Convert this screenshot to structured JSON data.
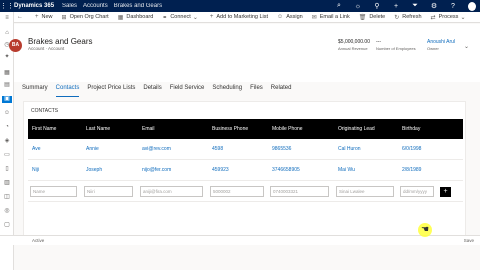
{
  "topbar": {
    "app_name": "Dynamics 365",
    "breadcrumbs": [
      "Sales",
      "Accounts",
      "Brakes and Gears"
    ],
    "icons": [
      "search-icon",
      "lightbulb-icon",
      "location-icon",
      "plus-icon",
      "filter-icon",
      "gear-icon",
      "help-icon"
    ]
  },
  "commands": [
    "New",
    "Open Org Chart",
    "Dashboard",
    "Connect",
    "Add to Marketing List",
    "Assign",
    "Email a Link",
    "Delete",
    "Refresh",
    "Process"
  ],
  "record": {
    "initials": "BA",
    "name": "Brakes and Gears",
    "subtitle": "Account · Account",
    "revenue": "$5,000,000.00",
    "revenue_label": "Annual Revenue",
    "employees": "---",
    "employees_label": "Number of Employees",
    "owner": "Anoushi Arul",
    "owner_label": "Owner"
  },
  "tabs": [
    "Summary",
    "Contacts",
    "Project Price Lists",
    "Details",
    "Field Service",
    "Scheduling",
    "Files",
    "Related"
  ],
  "active_tab": "Contacts",
  "contacts": {
    "title": "CONTACTS",
    "columns": [
      "First Name",
      "Last Name",
      "Email",
      "Business Phone",
      "Mobile Phone",
      "Originating Lead",
      "Birthday"
    ],
    "rows": [
      [
        "Ave",
        "Annie",
        "avi@rev.com",
        "4598",
        "9865536",
        "Cal Huron",
        "6/0/1998"
      ],
      [
        "Niji",
        "Joseph",
        "nijo@fer.com",
        "459923",
        "3746658905",
        "Mai Wu",
        "2/8/1989"
      ]
    ],
    "placeholders": [
      "Name",
      "Niiri",
      "aniji@fira.com",
      "5000002",
      "0740003321",
      "Sinai Lwalee",
      "dd/mm/yyyy"
    ],
    "add_label": "+"
  },
  "status": {
    "left": "Active",
    "right": "Save"
  }
}
